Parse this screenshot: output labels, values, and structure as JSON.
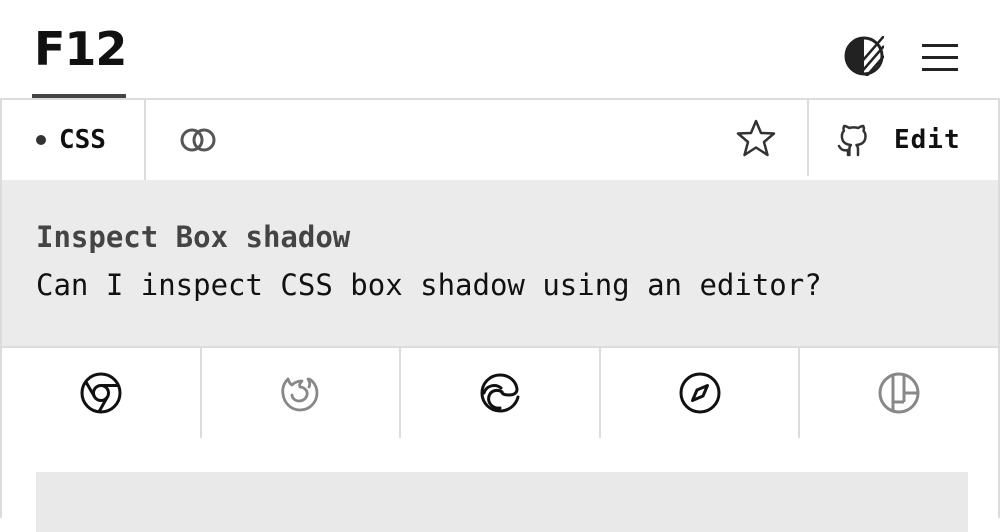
{
  "header": {
    "logo": "F12"
  },
  "toolbar": {
    "tag_label": "CSS",
    "edit_label": "Edit"
  },
  "question": {
    "title": "Inspect Box shadow",
    "text": "Can I inspect CSS box shadow using an editor?"
  },
  "browsers": [
    {
      "icon": "chrome-icon",
      "active": true
    },
    {
      "icon": "firefox-icon",
      "active": false
    },
    {
      "icon": "edge-icon",
      "active": true
    },
    {
      "icon": "safari-icon",
      "active": true
    },
    {
      "icon": "polypane-icon",
      "active": false
    }
  ],
  "colors": {
    "active_icon": "#111111",
    "inactive_icon": "#888888",
    "question_bg": "#ebebeb",
    "border": "#dcdcdc"
  }
}
